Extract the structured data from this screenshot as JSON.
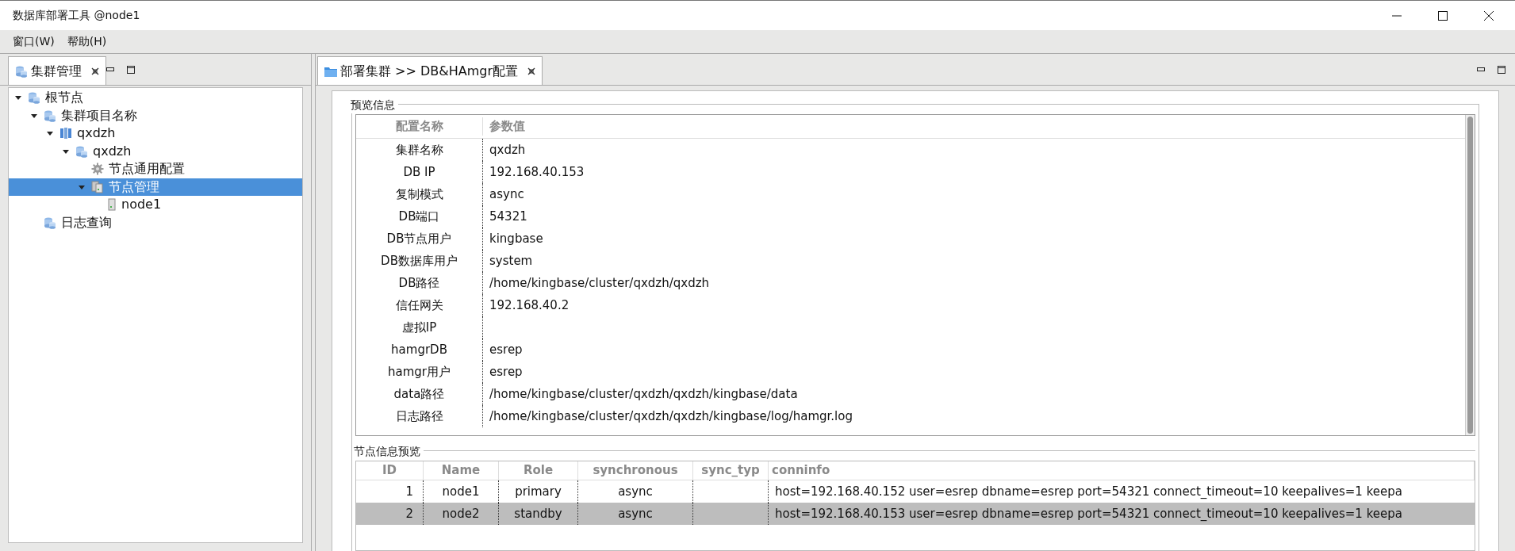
{
  "window": {
    "title": "数据库部署工具 @node1"
  },
  "menu": [
    "窗口(W)",
    "帮助(H)"
  ],
  "left_panel": {
    "tab": "集群管理",
    "tree": [
      {
        "label": "根节点",
        "kind": "group",
        "expanded": true,
        "selected": false,
        "children": [
          {
            "label": "集群项目名称",
            "kind": "group",
            "expanded": true,
            "selected": false,
            "children": [
              {
                "label": "qxdzh",
                "kind": "cluster",
                "expanded": true,
                "selected": false,
                "children": [
                  {
                    "label": "qxdzh",
                    "kind": "group",
                    "expanded": true,
                    "selected": false,
                    "children": [
                      {
                        "label": "节点通用配置",
                        "kind": "settings",
                        "selected": false
                      },
                      {
                        "label": "节点管理",
                        "kind": "nodes",
                        "expanded": true,
                        "selected": true,
                        "children": [
                          {
                            "label": "node1",
                            "kind": "server",
                            "selected": false
                          }
                        ]
                      }
                    ]
                  }
                ]
              }
            ]
          },
          {
            "label": "日志查询",
            "kind": "group",
            "selected": false
          }
        ]
      }
    ]
  },
  "editor": {
    "tab": "部署集群 >> DB&HAmgr配置",
    "preview": {
      "title": "预览信息",
      "columns": [
        "配置名称",
        "参数值"
      ],
      "rows": [
        [
          "集群名称",
          "qxdzh"
        ],
        [
          "DB IP",
          "192.168.40.153"
        ],
        [
          "复制模式",
          "async"
        ],
        [
          "DB端口",
          "54321"
        ],
        [
          "DB节点用户",
          "kingbase"
        ],
        [
          "DB数据库用户",
          "system"
        ],
        [
          "DB路径",
          "/home/kingbase/cluster/qxdzh/qxdzh"
        ],
        [
          "信任网关",
          "192.168.40.2"
        ],
        [
          "虚拟IP",
          ""
        ],
        [
          "hamgrDB",
          "esrep"
        ],
        [
          "hamgr用户",
          "esrep"
        ],
        [
          "data路径",
          "/home/kingbase/cluster/qxdzh/qxdzh/kingbase/data"
        ],
        [
          "日志路径",
          "/home/kingbase/cluster/qxdzh/qxdzh/kingbase/log/hamgr.log"
        ]
      ]
    },
    "nodes": {
      "title": "节点信息预览",
      "columns": [
        "ID",
        "Name",
        "Role",
        "synchronous",
        "sync_typ",
        "conninfo"
      ],
      "rows": [
        {
          "selected": false,
          "cells": [
            "1",
            "node1",
            "primary",
            "async",
            "",
            "host=192.168.40.152 user=esrep dbname=esrep port=54321 connect_timeout=10 keepalives=1 keepa"
          ]
        },
        {
          "selected": true,
          "cells": [
            "2",
            "node2",
            "standby",
            "async",
            "",
            "host=192.168.40.153 user=esrep dbname=esrep port=54321 connect_timeout=10 keepalives=1 keepa"
          ]
        }
      ]
    }
  }
}
